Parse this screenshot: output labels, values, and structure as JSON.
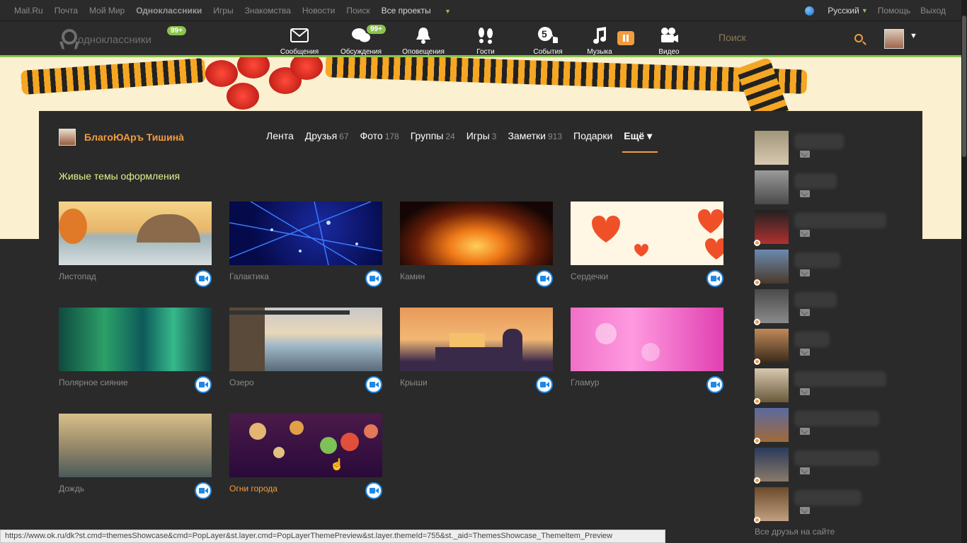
{
  "topbar": {
    "links": [
      "Mail.Ru",
      "Почта",
      "Мой Мир",
      "Одноклассники",
      "Игры",
      "Знакомства",
      "Новости",
      "Поиск",
      "Все проекты"
    ],
    "language": "Русский",
    "help": "Помощь",
    "logout": "Выход"
  },
  "header": {
    "logo_text": "одноклассники",
    "logo_badge": "99+",
    "nav": [
      {
        "label": "Сообщения",
        "icon": "envelope-icon"
      },
      {
        "label": "Обсуждения",
        "icon": "chat-bubbles-icon",
        "badge": "99+"
      },
      {
        "label": "Оповещения",
        "icon": "bell-icon"
      },
      {
        "label": "Гости",
        "icon": "footprints-icon"
      },
      {
        "label": "События",
        "icon": "events-5-icon"
      },
      {
        "label": "Музыка",
        "icon": "music-note-icon"
      },
      {
        "label": "Видео",
        "icon": "video-camera-icon"
      }
    ],
    "search_placeholder": "Поиск"
  },
  "profile": {
    "name": "БлагоЮАръ Тишинà"
  },
  "tabs": [
    {
      "label": "Лента",
      "count": ""
    },
    {
      "label": "Друзья",
      "count": "67"
    },
    {
      "label": "Фото",
      "count": "178"
    },
    {
      "label": "Группы",
      "count": "24"
    },
    {
      "label": "Игры",
      "count": "3"
    },
    {
      "label": "Заметки",
      "count": "913"
    },
    {
      "label": "Подарки",
      "count": ""
    },
    {
      "label": "Ещё ▾",
      "count": ""
    }
  ],
  "section_title": "Живые темы оформления",
  "themes": [
    {
      "label": "Листопад"
    },
    {
      "label": "Галактика"
    },
    {
      "label": "Камин"
    },
    {
      "label": "Сердечки"
    },
    {
      "label": "Полярное сияние"
    },
    {
      "label": "Озеро"
    },
    {
      "label": "Крыши"
    },
    {
      "label": "Гламур"
    },
    {
      "label": "Дождь"
    },
    {
      "label": "Огни города"
    }
  ],
  "all_friends": "Все друзья на сайте",
  "status_url": "https://www.ok.ru/dk?st.cmd=themesShowcase&cmd=PopLayer&st.layer.cmd=PopLayerThemePreview&st.layer.themeId=755&st._aid=ThemesShowcase_ThemeItem_Preview",
  "colors": {
    "accent": "#f39c3e",
    "green": "#8bc34a",
    "title": "#e4f18a",
    "video_blue": "#1e88e5"
  }
}
